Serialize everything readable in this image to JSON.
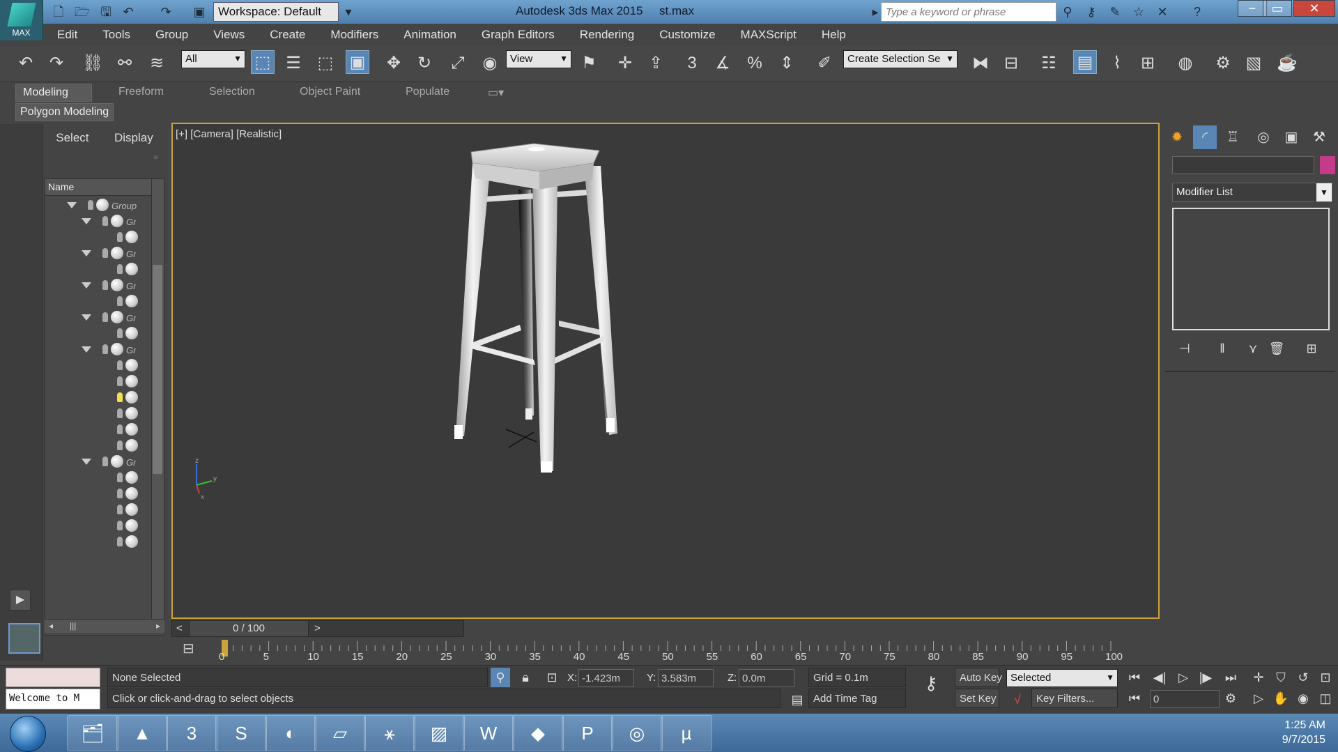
{
  "app": {
    "logo_label": "MAX",
    "workspace": "Workspace: Default",
    "title": "Autodesk 3ds Max 2015",
    "file": "st.max",
    "search_placeholder": "Type a keyword or phrase"
  },
  "menu": [
    "Edit",
    "Tools",
    "Group",
    "Views",
    "Create",
    "Modifiers",
    "Animation",
    "Graph Editors",
    "Rendering",
    "Customize",
    "MAXScript",
    "Help"
  ],
  "toolbar": {
    "selection_filter": "All",
    "ref_coord": "View",
    "named_selection_placeholder": "Create Selection Se",
    "snap_3d": "3",
    "angle_snap": "",
    "percent_snap": "%"
  },
  "ribbon": {
    "tabs": [
      "Modeling",
      "Freeform",
      "Selection",
      "Object Paint",
      "Populate"
    ],
    "active_tab": "Modeling",
    "panel": "Polygon Modeling"
  },
  "explorer": {
    "tabs": [
      "Select",
      "Display"
    ],
    "column": "Name",
    "rows": [
      {
        "level": 0,
        "expanded": true,
        "label": "Group"
      },
      {
        "level": 1,
        "expanded": true,
        "label": "Gr"
      },
      {
        "level": 2,
        "label": ""
      },
      {
        "level": 1,
        "expanded": true,
        "label": "Gr"
      },
      {
        "level": 2,
        "label": ""
      },
      {
        "level": 1,
        "expanded": true,
        "label": "Gr"
      },
      {
        "level": 2,
        "label": ""
      },
      {
        "level": 1,
        "expanded": true,
        "label": "Gr"
      },
      {
        "level": 2,
        "label": ""
      },
      {
        "level": 1,
        "expanded": true,
        "label": "Gr"
      },
      {
        "level": 2,
        "label": ""
      },
      {
        "level": 2,
        "label": ""
      },
      {
        "level": 2,
        "label": "",
        "light_on": true
      },
      {
        "level": 2,
        "label": ""
      },
      {
        "level": 2,
        "label": ""
      },
      {
        "level": 2,
        "label": ""
      },
      {
        "level": 1,
        "expanded": true,
        "label": "Gr"
      },
      {
        "level": 2,
        "label": ""
      },
      {
        "level": 2,
        "label": ""
      },
      {
        "level": 2,
        "label": ""
      },
      {
        "level": 2,
        "label": ""
      },
      {
        "level": 2,
        "label": ""
      }
    ]
  },
  "viewport": {
    "label": "[+] [Camera] [Realistic]",
    "axis_x": "x",
    "axis_y": "y",
    "axis_z": "z"
  },
  "command_panel": {
    "modifier_list": "Modifier List",
    "object_color": "#c43b8a"
  },
  "timeline": {
    "position": "0 / 100",
    "prev": "<",
    "next": ">",
    "ticks": [
      "0",
      "5",
      "10",
      "15",
      "20",
      "25",
      "30",
      "35",
      "40",
      "45",
      "50",
      "55",
      "60",
      "65",
      "70",
      "75",
      "80",
      "85",
      "90",
      "95",
      "100"
    ]
  },
  "status": {
    "maxscript_output": "Welcome to M",
    "selection": "None Selected",
    "prompt": "Click or click-and-drag to select objects",
    "x_label": "X:",
    "x_value": "-1.423m",
    "y_label": "Y:",
    "y_value": "3.583m",
    "z_label": "Z:",
    "z_value": "0.0m",
    "grid": "Grid = 0.1m",
    "add_time_tag": "Add Time Tag",
    "auto_key": "Auto Key",
    "set_key": "Set Key",
    "key_mode": "Selected",
    "key_filters": "Key Filters...",
    "frame": "0"
  },
  "taskbar": {
    "time": "1:25 AM",
    "date": "9/7/2015",
    "apps": [
      "explorer",
      "autocad",
      "3dsmax",
      "skype",
      "cinema4d",
      "folder",
      "figure",
      "photos",
      "word",
      "sketchup",
      "powerpoint",
      "chrome",
      "utorrent"
    ]
  }
}
